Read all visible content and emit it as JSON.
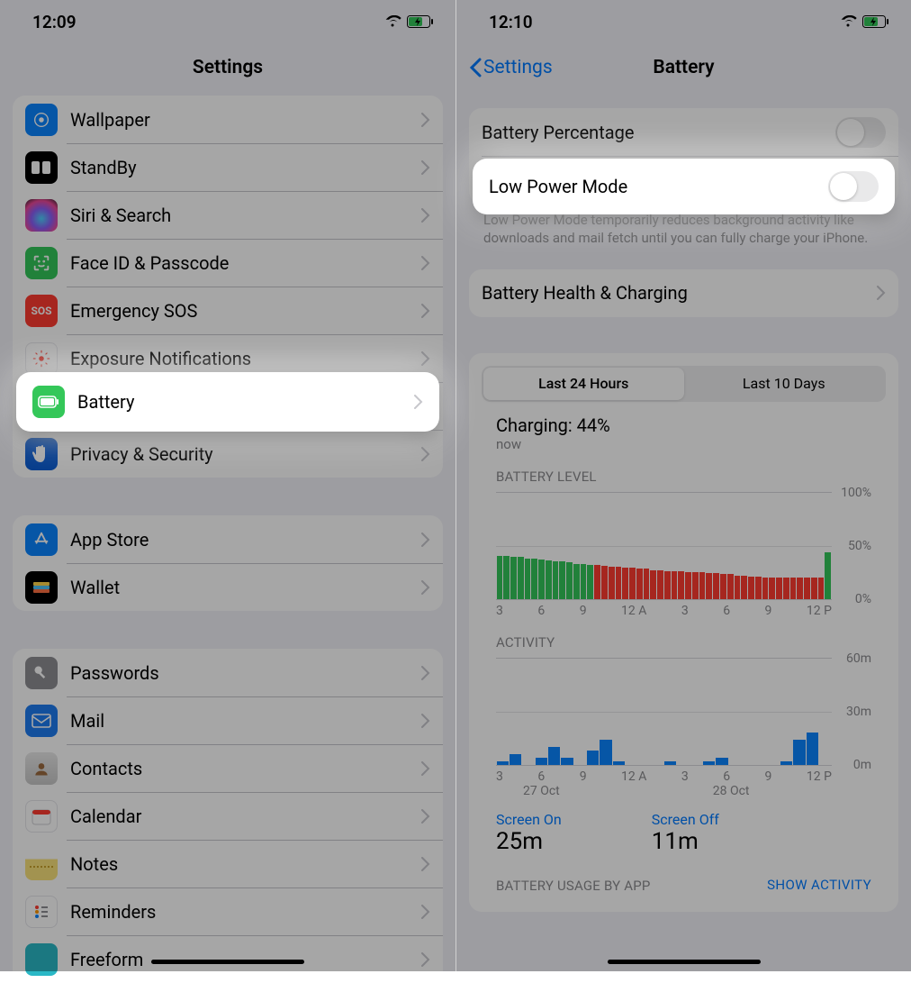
{
  "left": {
    "status_time": "12:09",
    "nav_title": "Settings",
    "highlight": {
      "label": "Battery",
      "icon": "battery-full-icon",
      "icon_bg": "#34c759"
    },
    "groups": [
      [
        {
          "icon": "wallpaper-icon",
          "bg": "#0a84ff",
          "label": "Wallpaper"
        },
        {
          "icon": "standby-icon",
          "bg": "#000000",
          "label": "StandBy"
        },
        {
          "icon": "siri-icon",
          "bg": "#1c1c1e",
          "label": "Siri & Search"
        },
        {
          "icon": "faceid-icon",
          "bg": "#34c759",
          "label": "Face ID & Passcode"
        },
        {
          "icon": "sos-icon",
          "bg": "#ff3b30",
          "label": "Emergency SOS",
          "text": "SOS"
        },
        {
          "icon": "exposure-icon",
          "bg": "#ffffff",
          "label": "Exposure Notifications",
          "fg": "#ff3b30"
        },
        {
          "icon": "battery-full-icon",
          "bg": "#34c759",
          "label": "Battery"
        },
        {
          "icon": "hand-icon",
          "bg": "#0a5dd6",
          "label": "Privacy & Security"
        }
      ],
      [
        {
          "icon": "appstore-icon",
          "bg": "#0a84ff",
          "label": "App Store"
        },
        {
          "icon": "wallet-icon",
          "bg": "#000000",
          "label": "Wallet"
        }
      ],
      [
        {
          "icon": "key-icon",
          "bg": "#8e8e93",
          "label": "Passwords"
        },
        {
          "icon": "mail-icon",
          "bg": "#1e7cf0",
          "label": "Mail"
        },
        {
          "icon": "contacts-icon",
          "bg": "#f7e7c8",
          "label": "Contacts"
        },
        {
          "icon": "calendar-icon",
          "bg": "#ffffff",
          "label": "Calendar",
          "fg": "#ff3b30"
        },
        {
          "icon": "notes-icon",
          "bg": "#f9e27b",
          "label": "Notes"
        },
        {
          "icon": "reminders-icon",
          "bg": "#ffffff",
          "label": "Reminders"
        },
        {
          "icon": "freeform-icon",
          "bg": "#2ab8c6",
          "label": "Freeform"
        }
      ]
    ]
  },
  "right": {
    "status_time": "12:10",
    "nav_back": "Settings",
    "nav_title": "Battery",
    "rows_top": [
      {
        "label": "Battery Percentage",
        "type": "toggle"
      }
    ],
    "highlight": {
      "label": "Low Power Mode",
      "type": "toggle"
    },
    "lpm_footer": "Low Power Mode temporarily reduces background activity like downloads and mail fetch until you can fully charge your iPhone.",
    "health_row": {
      "label": "Battery Health & Charging"
    },
    "segments": [
      "Last 24 Hours",
      "Last 10 Days"
    ],
    "segment_active": 0,
    "charging_line": "Charging: 44%",
    "charging_sub": "now",
    "battery_level_label": "BATTERY LEVEL",
    "activity_label": "ACTIVITY",
    "y_labels_pct": [
      "100%",
      "50%",
      "0%"
    ],
    "y_labels_min": [
      "60m",
      "30m",
      "0m"
    ],
    "x_ticks": [
      "3",
      "6",
      "9",
      "12 A",
      "3",
      "6",
      "9",
      "12 P"
    ],
    "dates": [
      "27 Oct",
      "28 Oct"
    ],
    "screen_on_label": "Screen On",
    "screen_on_value": "25m",
    "screen_off_label": "Screen Off",
    "screen_off_value": "11m",
    "usage_header": "BATTERY USAGE BY APP",
    "show_activity": "SHOW ACTIVITY"
  },
  "chart_data": [
    {
      "type": "bar",
      "title": "BATTERY LEVEL",
      "xlabel": "",
      "ylabel": "%",
      "ylim": [
        0,
        100
      ],
      "x_ticks": [
        "3",
        "6",
        "9",
        "12 A",
        "3",
        "6",
        "9",
        "12 P"
      ],
      "series": [
        {
          "name": "level_pct",
          "values": [
            40,
            40,
            39,
            39,
            38,
            38,
            37,
            36,
            35,
            35,
            34,
            33,
            33,
            32,
            32,
            31,
            30,
            30,
            29,
            29,
            28,
            28,
            27,
            27,
            26,
            26,
            26,
            25,
            25,
            25,
            24,
            24,
            23,
            23,
            22,
            22,
            21,
            21,
            20,
            20,
            20,
            20,
            20,
            20,
            20,
            20,
            20,
            44
          ]
        },
        {
          "name": "low_power_mode",
          "values": [
            false,
            false,
            false,
            false,
            false,
            false,
            false,
            false,
            false,
            false,
            false,
            false,
            false,
            false,
            true,
            true,
            true,
            true,
            true,
            true,
            true,
            true,
            true,
            true,
            true,
            true,
            true,
            true,
            true,
            true,
            true,
            true,
            true,
            true,
            true,
            true,
            true,
            true,
            true,
            true,
            true,
            true,
            true,
            true,
            true,
            true,
            true,
            false
          ]
        }
      ]
    },
    {
      "type": "bar",
      "title": "ACTIVITY",
      "xlabel": "",
      "ylabel": "minutes",
      "ylim": [
        0,
        60
      ],
      "x_ticks": [
        "3",
        "6",
        "9",
        "12 A",
        "3",
        "6",
        "9",
        "12 P"
      ],
      "values": [
        2,
        6,
        0,
        4,
        10,
        4,
        0,
        8,
        14,
        2,
        0,
        0,
        0,
        2,
        0,
        0,
        2,
        4,
        0,
        0,
        0,
        0,
        2,
        14,
        18,
        0
      ]
    }
  ]
}
